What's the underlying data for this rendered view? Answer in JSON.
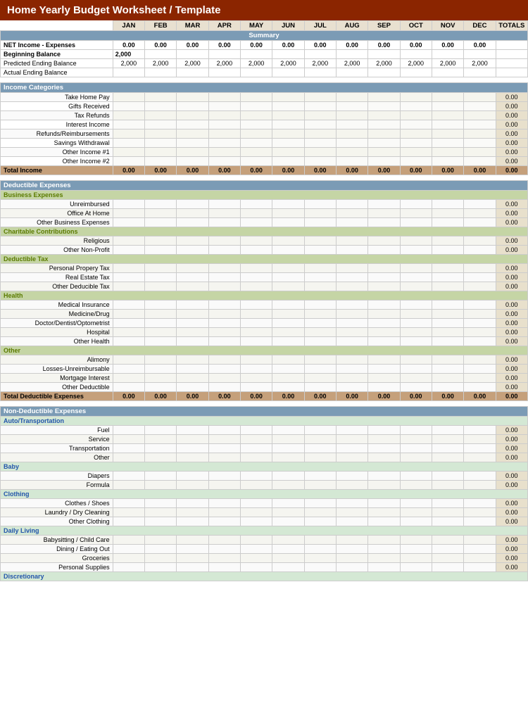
{
  "title": "Home Yearly Budget Worksheet / Template",
  "columns": {
    "label": "",
    "months": [
      "JAN",
      "FEB",
      "MAR",
      "APR",
      "MAY",
      "JUN",
      "JUL",
      "AUG",
      "SEP",
      "OCT",
      "NOV",
      "DEC"
    ],
    "totals": "TOTALS"
  },
  "summary": {
    "header": "Summary",
    "net_income_label": "NET Income - Expenses",
    "beginning_balance_label": "Beginning Balance",
    "beginning_balance_value": "2,000",
    "predicted_ending_label": "Predicted Ending Balance",
    "predicted_ending_value": "2,000",
    "actual_ending_label": "Actual Ending Balance",
    "net_values": [
      "0.00",
      "0.00",
      "0.00",
      "0.00",
      "0.00",
      "0.00",
      "0.00",
      "0.00",
      "0.00",
      "0.00",
      "0.00",
      "0.00"
    ]
  },
  "income": {
    "header": "Income Categories",
    "items": [
      "Take Home Pay",
      "Gifts Received",
      "Tax Refunds",
      "Interest Income",
      "Refunds/Reimbursements",
      "Savings Withdrawal",
      "Other Income #1",
      "Other Income #2"
    ],
    "total_label": "Total Income",
    "total_values": [
      "0.00",
      "0.00",
      "0.00",
      "0.00",
      "0.00",
      "0.00",
      "0.00",
      "0.00",
      "0.00",
      "0.00",
      "0.00",
      "0.00"
    ],
    "total_grand": "0.00"
  },
  "deductible": {
    "header": "Deductible Expenses",
    "subsections": [
      {
        "name": "Business Expenses",
        "items": [
          "Unreimbursed",
          "Office At Home",
          "Other Business Expenses"
        ]
      },
      {
        "name": "Charitable Contributions",
        "items": [
          "Religious",
          "Other Non-Profit"
        ]
      },
      {
        "name": "Deductible Tax",
        "items": [
          "Personal Propery Tax",
          "Real Estate Tax",
          "Other Deducible Tax"
        ]
      },
      {
        "name": "Health",
        "items": [
          "Medical Insurance",
          "Medicine/Drug",
          "Doctor/Dentist/Optometrist",
          "Hospital",
          "Other Health"
        ]
      },
      {
        "name": "Other",
        "items": [
          "Alimony",
          "Losses-Unreimbursable",
          "Mortgage Interest",
          "Other Deductible"
        ]
      }
    ],
    "total_label": "Total Deductible Expenses",
    "total_values": [
      "0.00",
      "0.00",
      "0.00",
      "0.00",
      "0.00",
      "0.00",
      "0.00",
      "0.00",
      "0.00",
      "0.00",
      "0.00",
      "0.00"
    ],
    "total_grand": "0.00"
  },
  "nondeductible": {
    "header": "Non-Deductible Expenses",
    "subsections": [
      {
        "name": "Auto/Transportation",
        "items": [
          "Fuel",
          "Service",
          "Transportation",
          "Other"
        ],
        "item_totals": [
          "0.00",
          "0.00",
          "0.00",
          "0.00"
        ]
      },
      {
        "name": "Baby",
        "items": [
          "Diapers",
          "Formula"
        ],
        "item_totals": [
          "0.00",
          "0.00"
        ]
      },
      {
        "name": "Clothing",
        "items": [
          "Clothes / Shoes",
          "Laundry / Dry Cleaning",
          "Other Clothing"
        ],
        "item_totals": [
          "0.00",
          "0.00",
          "0.00"
        ]
      },
      {
        "name": "Daily Living",
        "items": [
          "Babysitting / Child Care",
          "Dining / Eating Out",
          "Groceries",
          "Personal Supplies"
        ],
        "item_totals": [
          "0.00",
          "0.00",
          "0.00",
          "0.00"
        ]
      },
      {
        "name": "Discretionary",
        "items": [],
        "item_totals": []
      }
    ]
  }
}
